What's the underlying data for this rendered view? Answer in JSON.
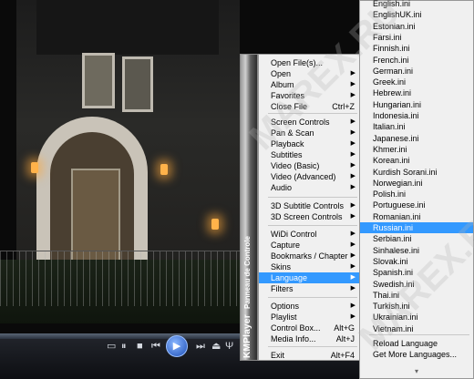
{
  "player": {
    "brand": "KMPlayer",
    "tagline": "Panneau de Controle"
  },
  "controls": {
    "play_icon": "play-icon",
    "buttons": [
      "stop",
      "prev",
      "next",
      "menu"
    ]
  },
  "menu": {
    "items": [
      {
        "label": "Open File(s)...",
        "shortcut": "",
        "arrow": false
      },
      {
        "label": "Open",
        "shortcut": "",
        "arrow": true
      },
      {
        "label": "Album",
        "shortcut": "",
        "arrow": true
      },
      {
        "label": "Favorites",
        "shortcut": "",
        "arrow": true
      },
      {
        "label": "Close File",
        "shortcut": "Ctrl+Z",
        "arrow": false
      },
      {
        "label": "Screen Controls",
        "shortcut": "",
        "arrow": true
      },
      {
        "label": "Pan & Scan",
        "shortcut": "",
        "arrow": true
      },
      {
        "label": "Playback",
        "shortcut": "",
        "arrow": true
      },
      {
        "label": "Subtitles",
        "shortcut": "",
        "arrow": true
      },
      {
        "label": "Video (Basic)",
        "shortcut": "",
        "arrow": true
      },
      {
        "label": "Video (Advanced)",
        "shortcut": "",
        "arrow": true
      },
      {
        "label": "Audio",
        "shortcut": "",
        "arrow": true
      },
      {
        "label": "3D Subtitle Controls",
        "shortcut": "",
        "arrow": true
      },
      {
        "label": "3D Screen Controls",
        "shortcut": "",
        "arrow": true
      },
      {
        "label": "WiDi Control",
        "shortcut": "",
        "arrow": true
      },
      {
        "label": "Capture",
        "shortcut": "",
        "arrow": true
      },
      {
        "label": "Bookmarks / Chapter",
        "shortcut": "",
        "arrow": true
      },
      {
        "label": "Skins",
        "shortcut": "",
        "arrow": true
      },
      {
        "label": "Language",
        "shortcut": "",
        "arrow": true
      },
      {
        "label": "Filters",
        "shortcut": "",
        "arrow": true
      },
      {
        "label": "Options",
        "shortcut": "",
        "arrow": true
      },
      {
        "label": "Playlist",
        "shortcut": "",
        "arrow": true
      },
      {
        "label": "Control Box...",
        "shortcut": "Alt+G",
        "arrow": false
      },
      {
        "label": "Media Info...",
        "shortcut": "Alt+J",
        "arrow": false
      },
      {
        "label": "Exit",
        "shortcut": "Alt+F4",
        "arrow": false
      }
    ],
    "highlighted": "Language"
  },
  "language_menu": {
    "items": [
      "English.ini",
      "EnglishUK.ini",
      "Estonian.ini",
      "Farsi.ini",
      "Finnish.ini",
      "French.ini",
      "German.ini",
      "Greek.ini",
      "Hebrew.ini",
      "Hungarian.ini",
      "Indonesia.ini",
      "Italian.ini",
      "Japanese.ini",
      "Khmer.ini",
      "Korean.ini",
      "Kurdish Sorani.ini",
      "Norwegian.ini",
      "Polish.ini",
      "Portuguese.ini",
      "Romanian.ini",
      "Russian.ini",
      "Serbian.ini",
      "Sinhalese.ini",
      "Slovak.ini",
      "Spanish.ini",
      "Swedish.ini",
      "Thai.ini",
      "Turkish.ini",
      "Ukrainian.ini",
      "Vietnam.ini"
    ],
    "highlighted": "Russian.ini",
    "reload": "Reload Language",
    "more": "Get More Languages..."
  },
  "watermark": "MAREX.RU"
}
